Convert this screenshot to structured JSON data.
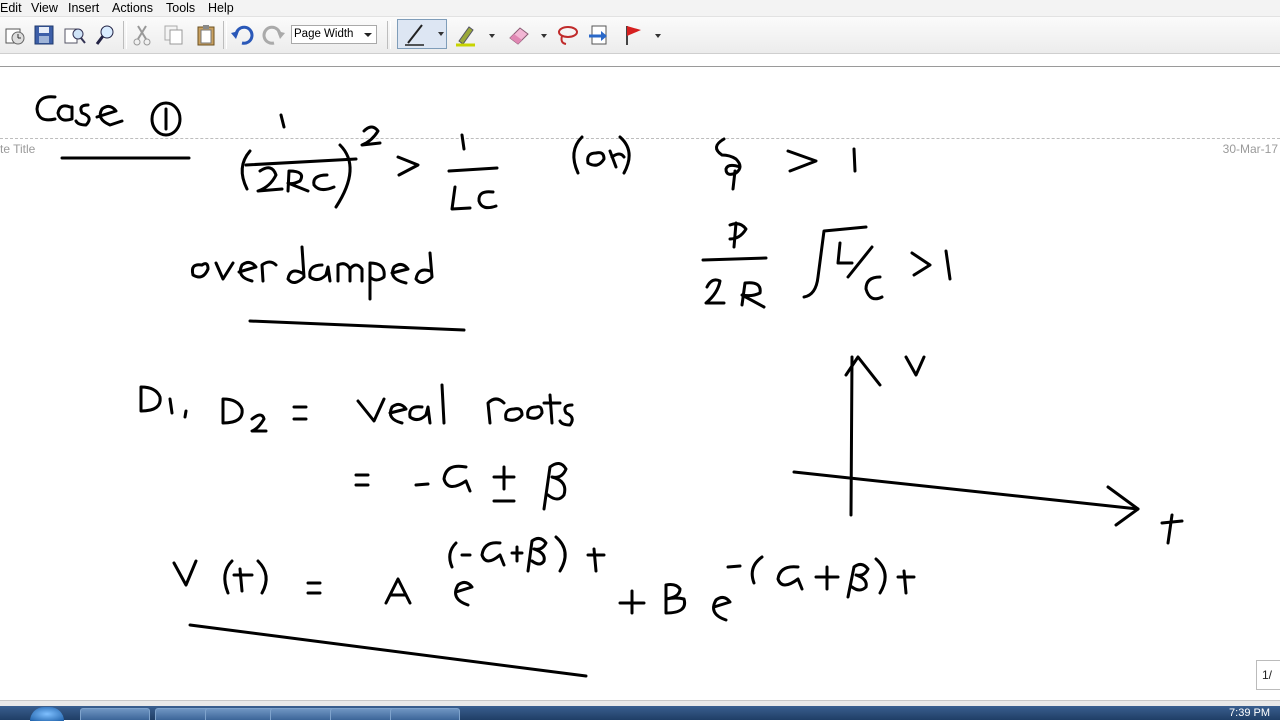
{
  "menu": [
    "Edit",
    "View",
    "Insert",
    "Actions",
    "Tools",
    "Help"
  ],
  "toolbar": {
    "zoom_value": "Page Width",
    "icons": [
      "new-page-icon",
      "save-icon",
      "find-icon",
      "zoom-icon",
      "cut-icon",
      "copy-icon",
      "paste-icon",
      "undo-icon",
      "redo-icon",
      "pen-icon",
      "highlighter-icon",
      "eraser-icon",
      "lasso-icon",
      "insert-space-icon",
      "flag-icon"
    ]
  },
  "note": {
    "title_placeholder": "te Title",
    "date": "30-Mar-17"
  },
  "page_counter": "1/",
  "taskbar": {
    "clock": "7:39 PM"
  },
  "colors": {
    "ink": "#000000",
    "menubar": "#f3f3f3",
    "taskbar": "#2a4a76"
  }
}
